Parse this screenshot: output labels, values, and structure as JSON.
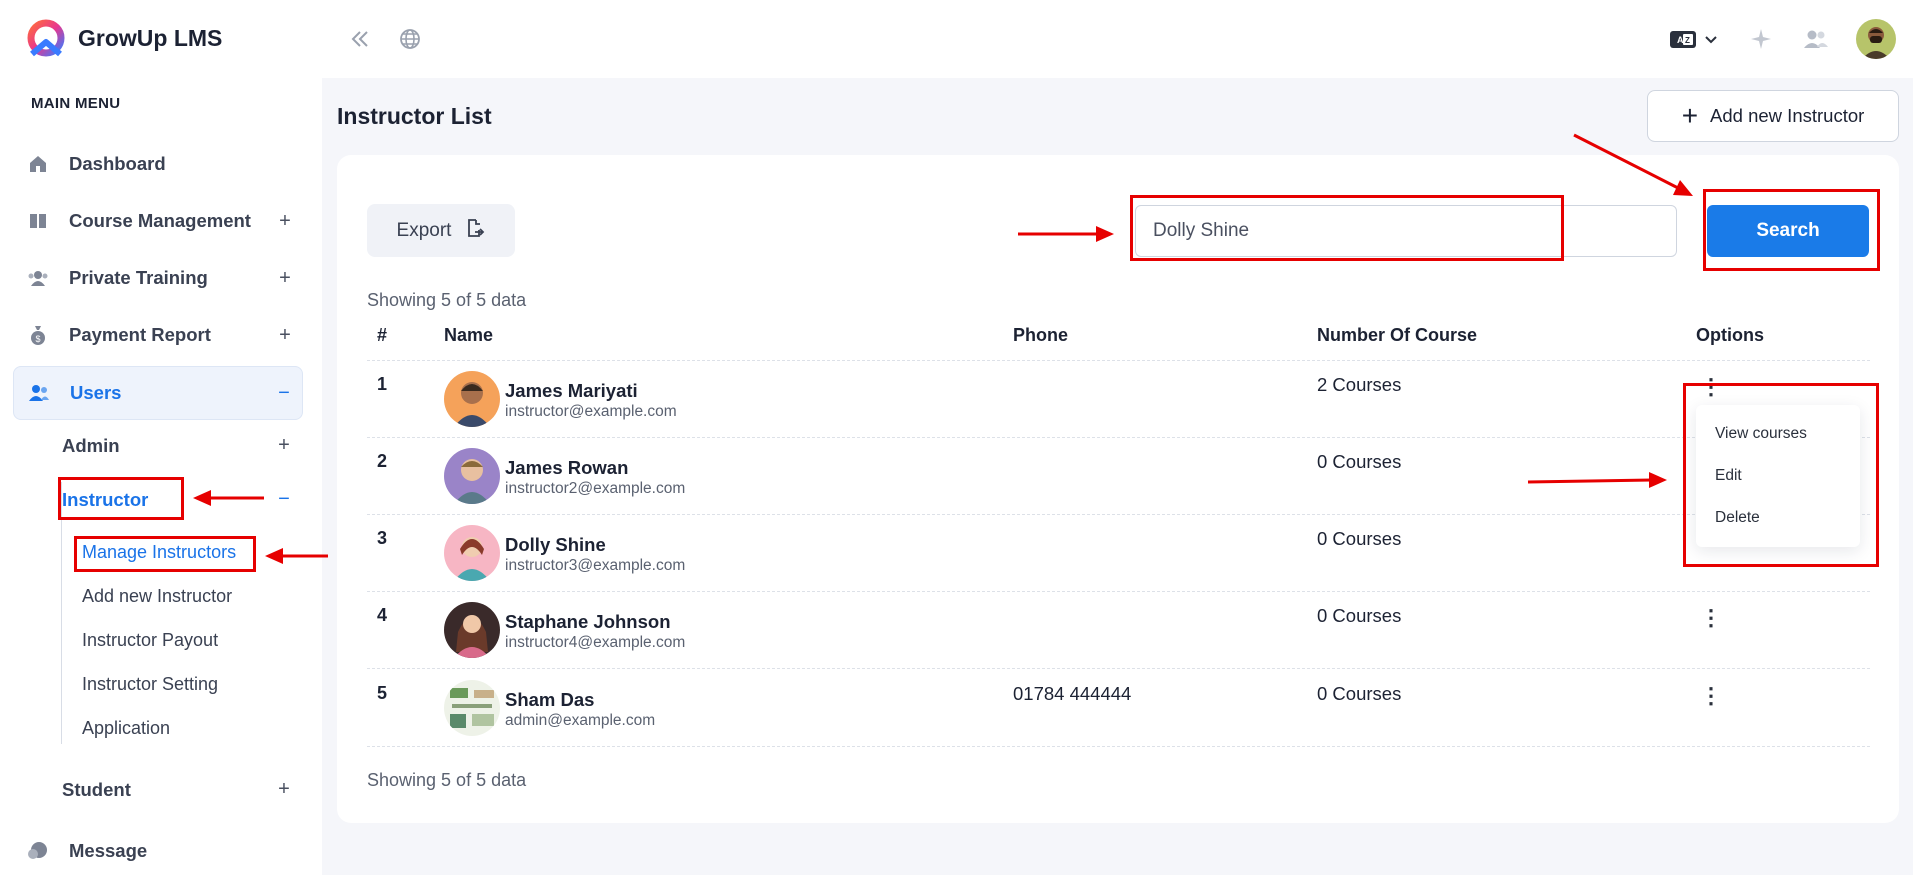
{
  "app": {
    "name": "GrowUp LMS"
  },
  "sidebar": {
    "menu_title": "MAIN MENU",
    "items": [
      {
        "label": "Dashboard",
        "icon": "home-icon"
      },
      {
        "label": "Course Management",
        "icon": "book-icon",
        "toggle": "+"
      },
      {
        "label": "Private Training",
        "icon": "group-icon",
        "toggle": "+"
      },
      {
        "label": "Payment Report",
        "icon": "money-bag-icon",
        "toggle": "+"
      },
      {
        "label": "Users",
        "icon": "users-icon",
        "toggle": "−"
      }
    ],
    "users_children": [
      {
        "label": "Admin",
        "toggle": "+"
      },
      {
        "label": "Instructor",
        "toggle": "−"
      },
      {
        "label": "Student",
        "toggle": "+"
      }
    ],
    "instructor_children": [
      "Manage Instructors",
      "Add new Instructor",
      "Instructor Payout",
      "Instructor Setting",
      "Application"
    ],
    "message": {
      "label": "Message",
      "icon": "chat-icon"
    }
  },
  "page": {
    "title": "Instructor List",
    "add_button": "Add new Instructor",
    "export_button": "Export",
    "search": {
      "value": "Dolly Shine",
      "button": "Search"
    },
    "showing_top": "Showing 5 of 5 data",
    "showing_bottom": "Showing 5 of 5 data"
  },
  "table": {
    "headers": [
      "#",
      "Name",
      "Phone",
      "Number Of Course",
      "Options"
    ],
    "rows": [
      {
        "num": "1",
        "name": "James Mariyati",
        "email": "instructor@example.com",
        "phone": "",
        "courses": "2 Courses"
      },
      {
        "num": "2",
        "name": "James Rowan",
        "email": "instructor2@example.com",
        "phone": "",
        "courses": "0 Courses"
      },
      {
        "num": "3",
        "name": "Dolly Shine",
        "email": "instructor3@example.com",
        "phone": "",
        "courses": "0 Courses"
      },
      {
        "num": "4",
        "name": "Staphane Johnson",
        "email": "instructor4@example.com",
        "phone": "",
        "courses": "0 Courses"
      },
      {
        "num": "5",
        "name": "Sham Das",
        "email": "admin@example.com",
        "phone": "01784 444444",
        "courses": "0 Courses"
      }
    ]
  },
  "options_menu": [
    "View courses",
    "Edit",
    "Delete"
  ],
  "colors": {
    "accent": "#1a7be8",
    "annotation": "#e60000"
  }
}
